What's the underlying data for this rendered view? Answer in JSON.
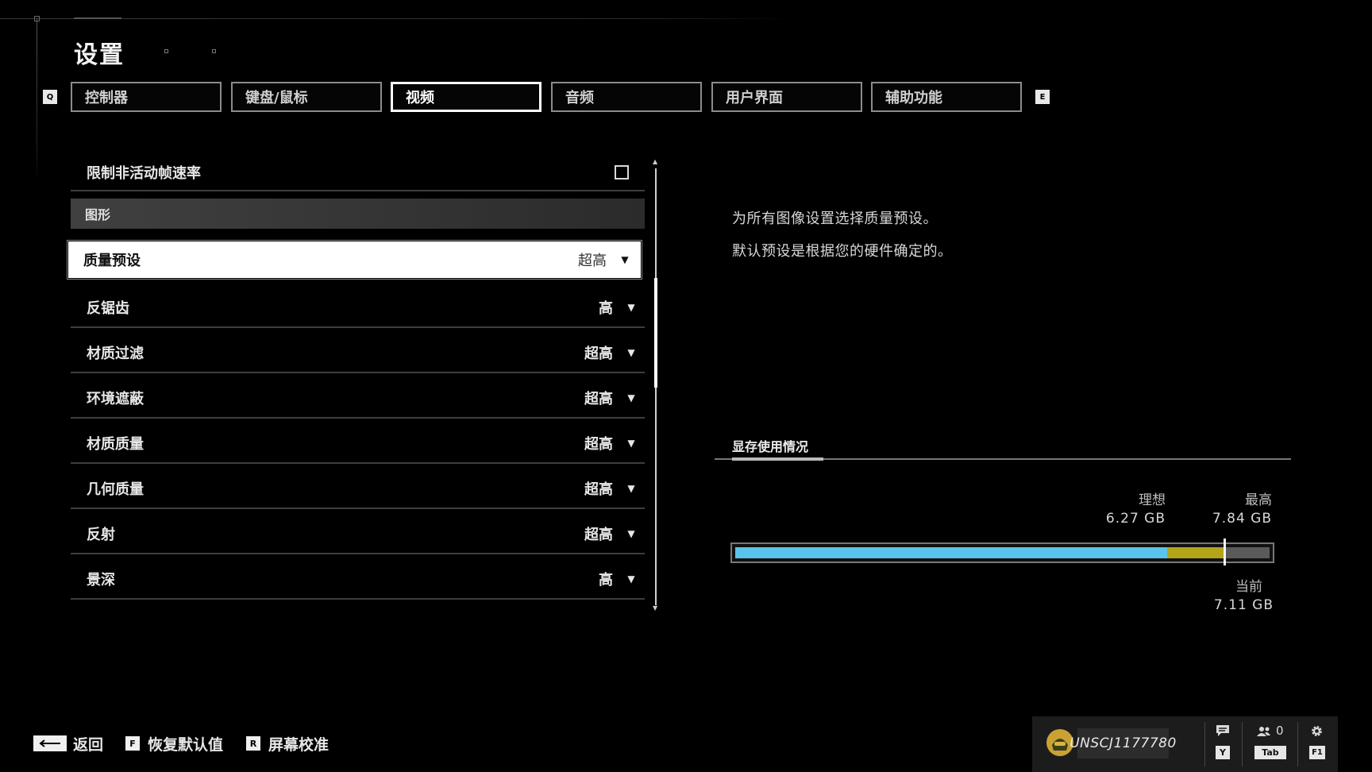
{
  "page": {
    "title": "设置"
  },
  "tabs": {
    "prev_key": "Q",
    "next_key": "E",
    "items": [
      {
        "label": "控制器"
      },
      {
        "label": "键盘/鼠标"
      },
      {
        "label": "视频",
        "active": true
      },
      {
        "label": "音频"
      },
      {
        "label": "用户界面"
      },
      {
        "label": "辅助功能"
      }
    ]
  },
  "settings": {
    "limit_fps": {
      "label": "限制非活动帧速率",
      "checked": false
    },
    "section_graphics": "图形",
    "rows": [
      {
        "label": "质量预设",
        "value": "超高"
      },
      {
        "label": "反锯齿",
        "value": "高"
      },
      {
        "label": "材质过滤",
        "value": "超高"
      },
      {
        "label": "环境遮蔽",
        "value": "超高"
      },
      {
        "label": "材质质量",
        "value": "超高"
      },
      {
        "label": "几何质量",
        "value": "超高"
      },
      {
        "label": "反射",
        "value": "超高"
      },
      {
        "label": "景深",
        "value": "高"
      }
    ],
    "dropdown_glyph": "▼"
  },
  "description": {
    "line1": "为所有图像设置选择质量预设。",
    "line2": "默认预设是根据您的硬件确定的。"
  },
  "vram": {
    "title": "显存使用情况",
    "ideal_label": "理想",
    "ideal_value": "6.27 GB",
    "max_label": "最高",
    "max_value": "7.84 GB",
    "current_label": "当前",
    "current_value": "7.11 GB",
    "colors": {
      "ideal": "#5bc3ea",
      "over": "#b3a41a",
      "remaining": "#5a5a5a"
    }
  },
  "footer": {
    "back_label": "返回",
    "restore_key": "F",
    "restore_label": "恢复默认值",
    "calibrate_key": "R",
    "calibrate_label": "屏幕校准"
  },
  "player": {
    "gamertag": "UNSCJ1177780",
    "chat_key": "Y",
    "friends_count": "0",
    "friends_key": "Tab",
    "settings_key": "F1"
  }
}
